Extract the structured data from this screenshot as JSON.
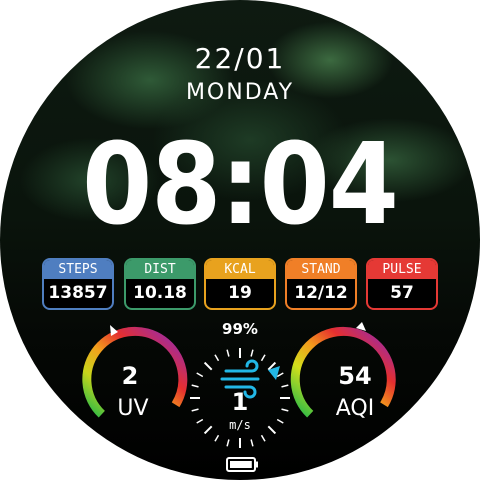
{
  "date": "22/01",
  "weekday": "MONDAY",
  "time": "08:04",
  "stats": [
    {
      "label": "STEPS",
      "value": "13857",
      "color": "#4f7ec0"
    },
    {
      "label": "DIST",
      "value": "10.18",
      "color": "#3c9a6a"
    },
    {
      "label": "KCAL",
      "value": "19",
      "color": "#e8a21e"
    },
    {
      "label": "STAND",
      "value": "12/12",
      "color": "#f07f27"
    },
    {
      "label": "PULSE",
      "value": "57",
      "color": "#e53935"
    }
  ],
  "uv": {
    "value": "2",
    "label": "UV"
  },
  "aqi": {
    "value": "54",
    "label": "AQI"
  },
  "wind": {
    "value": "1",
    "unit": "m/s"
  },
  "battery": {
    "percent": "99%",
    "level": 0.99
  }
}
